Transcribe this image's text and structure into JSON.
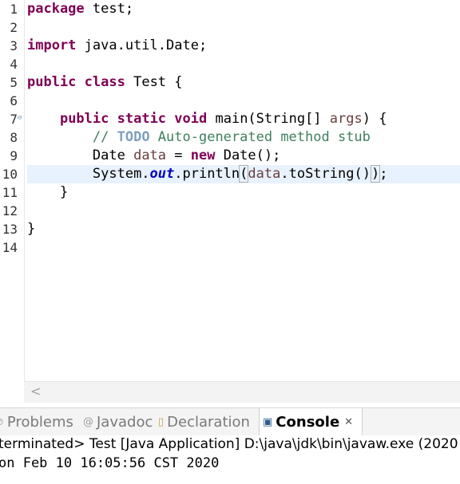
{
  "editor": {
    "line_numbers": [
      "1",
      "2",
      "3",
      "4",
      "5",
      "6",
      "7",
      "8",
      "9",
      "10",
      "11",
      "12",
      "13",
      "14"
    ],
    "current_line": "10",
    "fold_marker": "⊖",
    "lines": {
      "l1": {
        "kw": "package",
        "rest": " test;"
      },
      "l3": {
        "kw": "import",
        "rest": " java.util.Date;"
      },
      "l5": {
        "kw1": "public",
        "kw2": "class",
        "rest": " Test {"
      },
      "l7": {
        "kw1": "public",
        "kw2": "static",
        "kw3": "void",
        "mid": " main(String[] ",
        "arg": "args",
        "end": ") {"
      },
      "l8": {
        "comment_start": "// ",
        "todo": "TODO",
        "comment_rest": " Auto-generated method stub"
      },
      "l9": {
        "type": "Date ",
        "var": "data",
        "eq": " = ",
        "kw": "new",
        "rest": " Date();"
      },
      "l10": {
        "a": "System.",
        "field": "out",
        "b": ".println",
        "paren_open": "(",
        "var": "data",
        "c": ".toString()",
        "paren_close": ")",
        "end": ";"
      },
      "l11": {
        "text": "}"
      },
      "l13": {
        "text": "}"
      }
    },
    "scroll_left_arrow": "<"
  },
  "panel": {
    "tabs": [
      {
        "icon": "⊘",
        "label": "Problems"
      },
      {
        "icon": "@",
        "label": "Javadoc"
      },
      {
        "icon": "▯",
        "label": "Declaration"
      },
      {
        "icon": "▣",
        "label": "Console",
        "close": "✕"
      }
    ],
    "console": {
      "status": "terminated> Test [Java Application] D:\\java\\jdk\\bin\\javaw.exe (2020",
      "output": "on Feb 10 16:05:56 CST 2020"
    }
  },
  "colors": {
    "keyword": "#7f0055",
    "comment": "#3f7f5f",
    "todo": "#7f9fbf",
    "local_variable": "#6a3e3e",
    "static_field": "#0000c0",
    "current_line_highlight": "#e8f2fe"
  }
}
